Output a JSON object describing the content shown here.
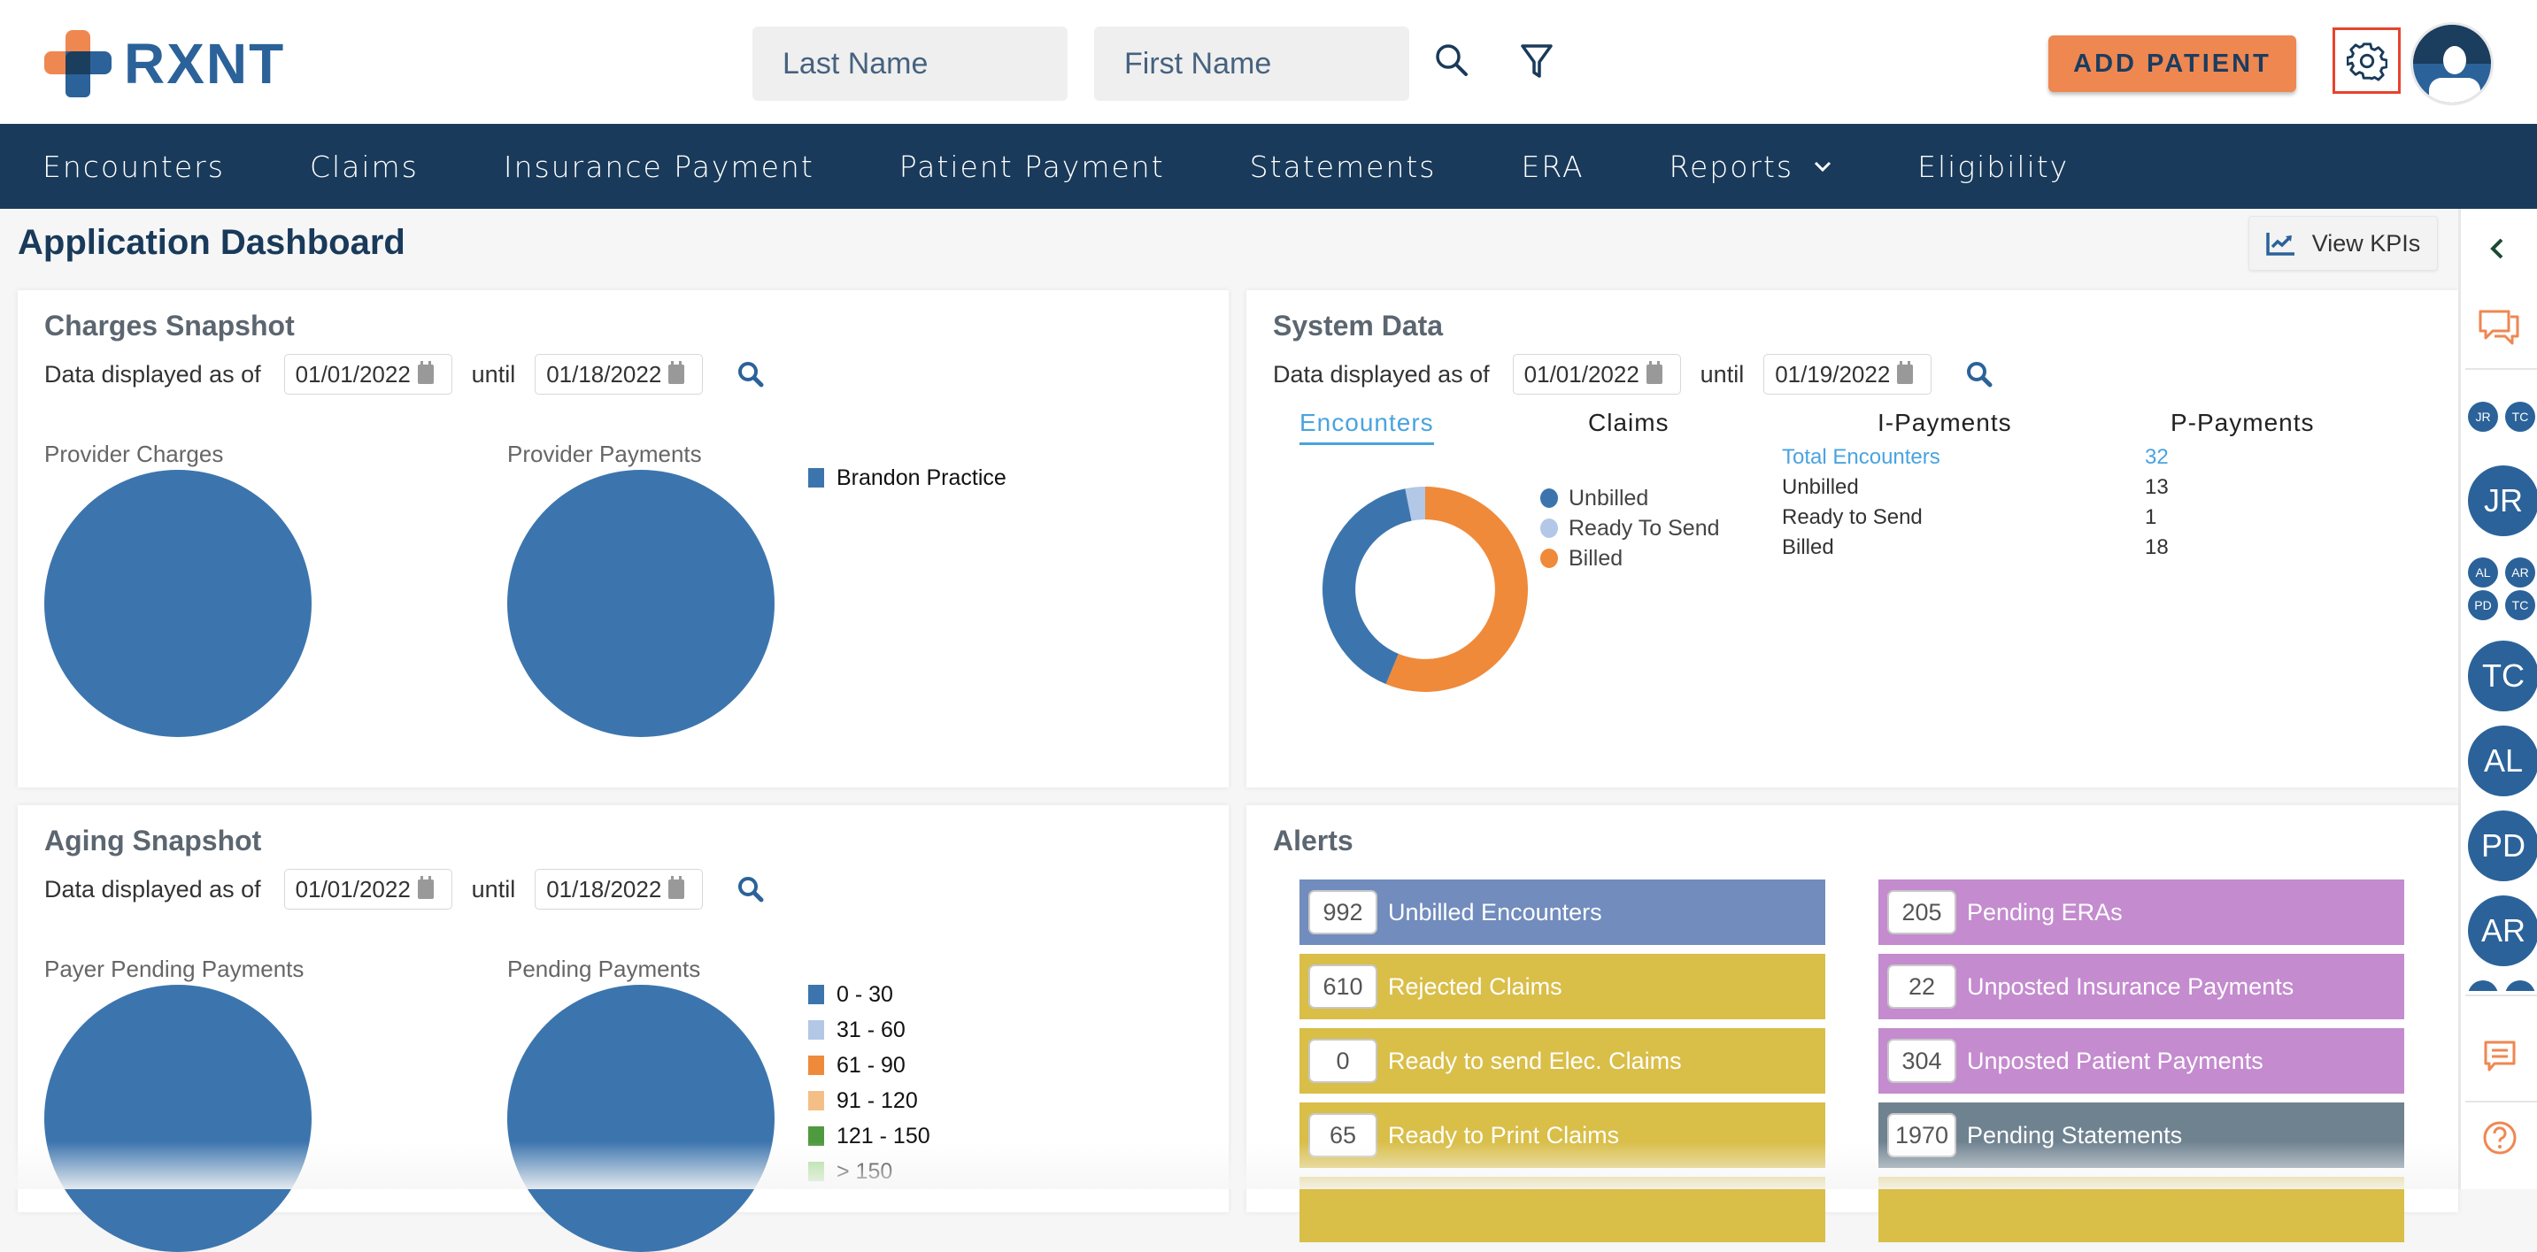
{
  "header": {
    "logo_text": "RXNT",
    "last_name_placeholder": "Last Name",
    "first_name_placeholder": "First Name",
    "add_patient_label": "ADD PATIENT"
  },
  "nav": {
    "items": [
      {
        "label": "Encounters"
      },
      {
        "label": "Claims"
      },
      {
        "label": "Insurance Payment"
      },
      {
        "label": "Patient Payment"
      },
      {
        "label": "Statements"
      },
      {
        "label": "ERA"
      },
      {
        "label": "Reports",
        "has_dropdown": true
      },
      {
        "label": "Eligibility"
      }
    ]
  },
  "page": {
    "title": "Application Dashboard",
    "view_kpis_label": "View KPIs"
  },
  "charges_snapshot": {
    "title": "Charges Snapshot",
    "date_label": "Data displayed as of",
    "from_date": "01/01/2022",
    "until_label": "until",
    "to_date": "01/18/2022",
    "provider_charges_label": "Provider Charges",
    "provider_payments_label": "Provider Payments",
    "legend": [
      {
        "label": "Brandon Practice",
        "color": "#3c75ae"
      }
    ]
  },
  "system_data": {
    "title": "System Data",
    "date_label": "Data displayed as of",
    "from_date": "01/01/2022",
    "until_label": "until",
    "to_date": "01/19/2022",
    "tabs": [
      {
        "label": "Encounters",
        "active": true
      },
      {
        "label": "Claims",
        "active": false
      },
      {
        "label": "I-Payments",
        "active": false
      },
      {
        "label": "P-Payments",
        "active": false
      }
    ],
    "donut_legend": [
      {
        "label": "Unbilled",
        "color": "#3c75ae"
      },
      {
        "label": "Ready To Send",
        "color": "#b3c7e6"
      },
      {
        "label": "Billed",
        "color": "#ef8a3a"
      }
    ],
    "details": [
      {
        "label": "Total Encounters",
        "value": "32",
        "highlight": true
      },
      {
        "label": "Unbilled",
        "value": "13"
      },
      {
        "label": "Ready to Send",
        "value": "1"
      },
      {
        "label": "Billed",
        "value": "18"
      }
    ]
  },
  "aging_snapshot": {
    "title": "Aging Snapshot",
    "date_label": "Data displayed as of",
    "from_date": "01/01/2022",
    "until_label": "until",
    "to_date": "01/18/2022",
    "payer_pending_label": "Payer Pending Payments",
    "pending_payments_label": "Pending Payments",
    "legend": [
      {
        "label": "0 - 30",
        "color": "#3c75ae"
      },
      {
        "label": "31 - 60",
        "color": "#b3c7e6"
      },
      {
        "label": "61 - 90",
        "color": "#ef8a3a"
      },
      {
        "label": "91 - 120",
        "color": "#f3bf86"
      },
      {
        "label": "121 - 150",
        "color": "#4f9a3e"
      },
      {
        "label": "> 150",
        "color": "#a3d98e"
      }
    ]
  },
  "alerts": {
    "title": "Alerts",
    "left": [
      {
        "count": "992",
        "label": "Unbilled Encounters",
        "color": "#718cbd"
      },
      {
        "count": "610",
        "label": "Rejected Claims",
        "color": "#d9be48"
      },
      {
        "count": "0",
        "label": "Ready to send Elec. Claims",
        "color": "#d9be48"
      },
      {
        "count": "65",
        "label": "Ready to Print Claims",
        "color": "#d9be48"
      }
    ],
    "right": [
      {
        "count": "205",
        "label": "Pending ERAs",
        "color": "#c48bcf"
      },
      {
        "count": "22",
        "label": "Unposted Insurance Payments",
        "color": "#c48bcf"
      },
      {
        "count": "304",
        "label": "Unposted Patient Payments",
        "color": "#c48bcf"
      },
      {
        "count": "1970",
        "label": "Pending Statements",
        "color": "#6f8290"
      }
    ]
  },
  "right_sidebar": {
    "group_top": [
      "JR",
      "TC"
    ],
    "single_1": "JR",
    "group_mid": [
      "AL",
      "AR",
      "PD",
      "TC"
    ],
    "singles": [
      "TC",
      "AL",
      "PD",
      "AR"
    ]
  },
  "chart_data": [
    {
      "type": "pie",
      "title": "Provider Charges",
      "categories": [
        "Brandon Practice"
      ],
      "values": [
        100
      ]
    },
    {
      "type": "pie",
      "title": "Provider Payments",
      "categories": [
        "Brandon Practice"
      ],
      "values": [
        100
      ]
    },
    {
      "type": "pie",
      "subtype": "donut",
      "title": "Encounters",
      "categories": [
        "Billed",
        "Unbilled",
        "Ready To Send"
      ],
      "values": [
        18,
        13,
        1
      ],
      "colors": [
        "#ef8a3a",
        "#3c75ae",
        "#b3c7e6"
      ]
    },
    {
      "type": "pie",
      "title": "Payer Pending Payments",
      "categories": [
        "0 - 30",
        "31 - 60",
        "61 - 90",
        "91 - 120",
        "121 - 150",
        "> 150"
      ],
      "values": [
        100,
        0,
        0,
        0,
        0,
        0
      ]
    },
    {
      "type": "pie",
      "title": "Pending Payments",
      "categories": [
        "0 - 30",
        "31 - 60",
        "61 - 90",
        "91 - 120",
        "121 - 150",
        "> 150"
      ],
      "values": [
        100,
        0,
        0,
        0,
        0,
        0
      ]
    }
  ]
}
